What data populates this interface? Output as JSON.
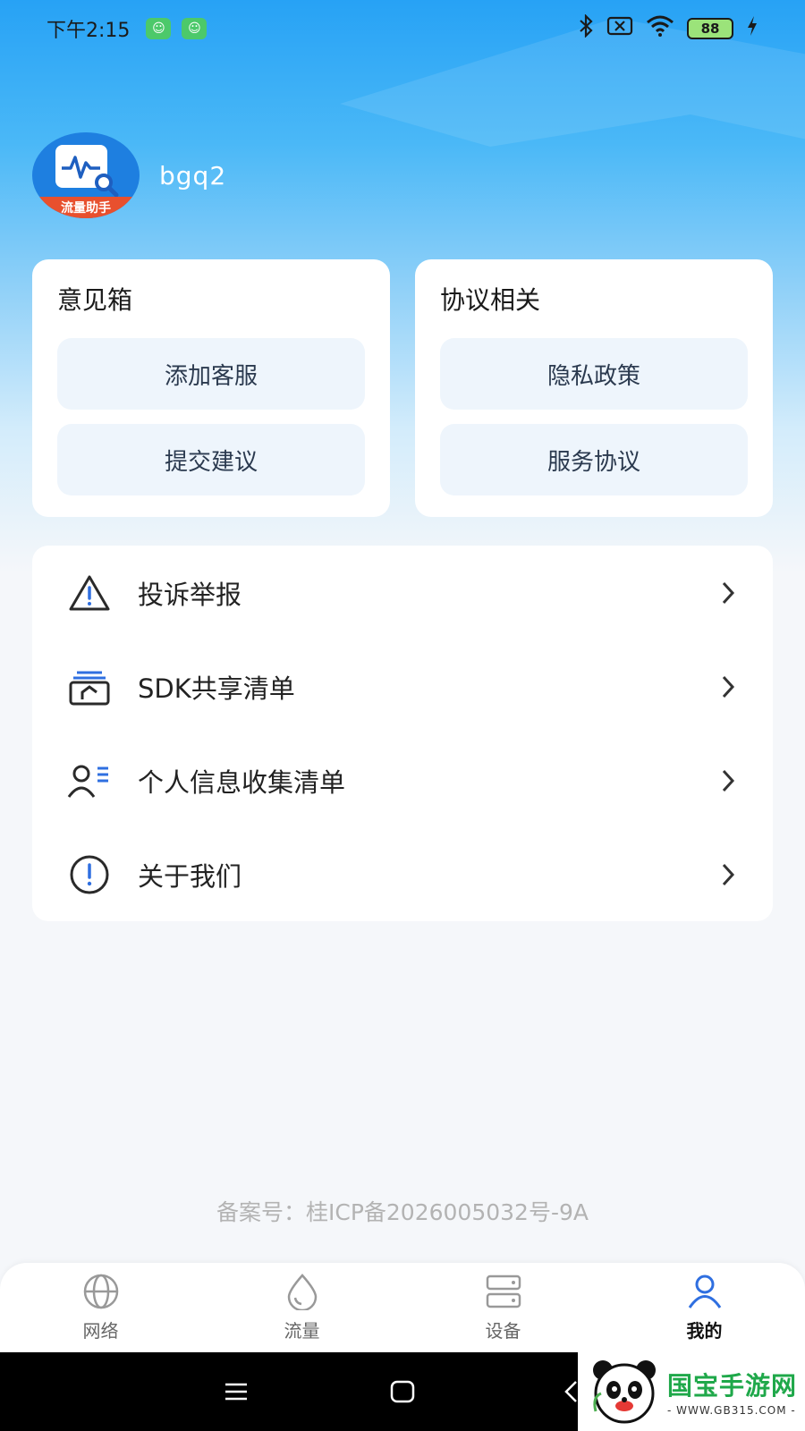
{
  "status_bar": {
    "time": "下午2:15",
    "battery": "88"
  },
  "profile": {
    "username": "bgq2",
    "avatar_caption": "流量助手"
  },
  "feedback_card": {
    "title": "意见箱",
    "buttons": [
      "添加客服",
      "提交建议"
    ]
  },
  "agreement_card": {
    "title": "协议相关",
    "buttons": [
      "隐私政策",
      "服务协议"
    ]
  },
  "menu": [
    {
      "label": "投诉举报",
      "icon": "warning-icon"
    },
    {
      "label": "SDK共享清单",
      "icon": "share-list-icon"
    },
    {
      "label": "个人信息收集清单",
      "icon": "user-list-icon"
    },
    {
      "label": "关于我们",
      "icon": "info-icon"
    }
  ],
  "icp": "备案号：桂ICP备2026005032号-9A",
  "tabs": [
    {
      "label": "网络",
      "icon": "globe-icon"
    },
    {
      "label": "流量",
      "icon": "drop-icon"
    },
    {
      "label": "设备",
      "icon": "server-icon"
    },
    {
      "label": "我的",
      "icon": "user-icon",
      "active": true
    }
  ],
  "watermark": {
    "title": "国宝手游网",
    "url": "- WWW.GB315.COM -"
  },
  "colors": {
    "accent": "#2f6fe0",
    "hero_top": "#27a2f5",
    "pill_bg": "#eef5fc"
  }
}
